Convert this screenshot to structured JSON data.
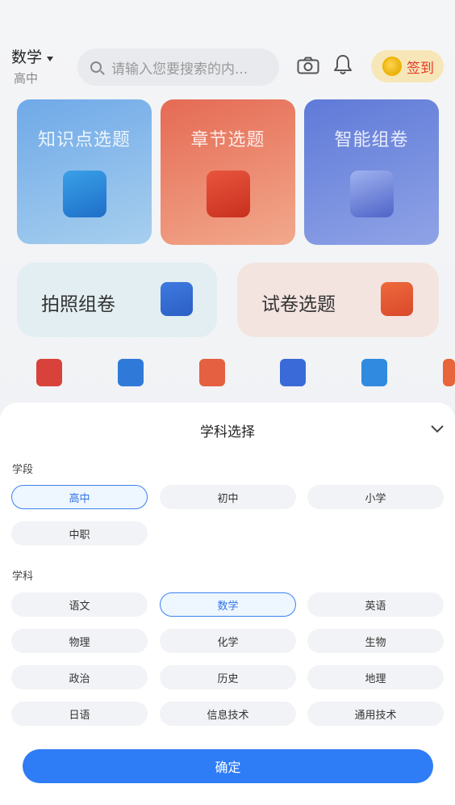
{
  "header": {
    "subject": "数学",
    "level": "高中",
    "search_placeholder": "请输入您要搜索的内...",
    "checkin_label": "签到"
  },
  "cards": {
    "knowledge": "知识点选题",
    "chapter": "章节选题",
    "smart": "智能组卷",
    "photo": "拍照组卷",
    "paper": "试卷选题"
  },
  "colors": {
    "accent": "#2e7cf6",
    "selected_bg": "#eef6ff",
    "checkin_text": "#e53a2b"
  },
  "sheet": {
    "title": "学科选择",
    "stage_label": "学段",
    "subject_label": "学科",
    "stages": [
      {
        "label": "高中",
        "selected": true
      },
      {
        "label": "初中",
        "selected": false
      },
      {
        "label": "小学",
        "selected": false
      },
      {
        "label": "中职",
        "selected": false
      }
    ],
    "subjects": [
      {
        "label": "语文",
        "selected": false
      },
      {
        "label": "数学",
        "selected": true
      },
      {
        "label": "英语",
        "selected": false
      },
      {
        "label": "物理",
        "selected": false
      },
      {
        "label": "化学",
        "selected": false
      },
      {
        "label": "生物",
        "selected": false
      },
      {
        "label": "政治",
        "selected": false
      },
      {
        "label": "历史",
        "selected": false
      },
      {
        "label": "地理",
        "selected": false
      },
      {
        "label": "日语",
        "selected": false
      },
      {
        "label": "信息技术",
        "selected": false
      },
      {
        "label": "通用技术",
        "selected": false
      }
    ],
    "confirm_label": "确定"
  }
}
